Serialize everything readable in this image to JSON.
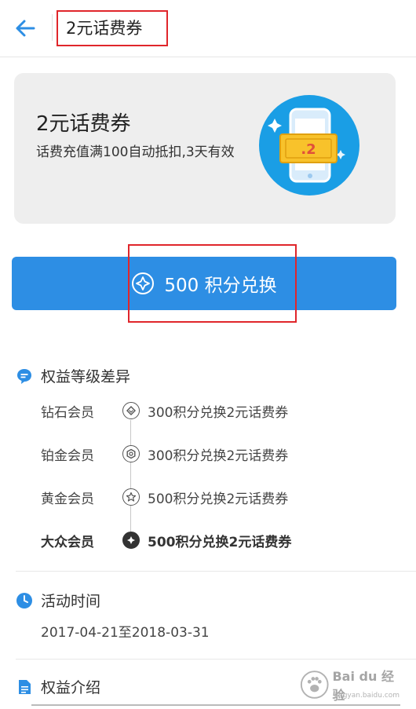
{
  "header": {
    "title": "2元话费券",
    "back_icon": "back-arrow-icon"
  },
  "card": {
    "title": "2元话费券",
    "description": "话费充值满100自动抵扣,3天有效",
    "illustration": "phone-coupon-icon",
    "coupon_value": ".2"
  },
  "redeem": {
    "label": "500 积分兑换",
    "icon": "points-diamond-icon"
  },
  "tiers_section": {
    "title": "权益等级差异",
    "icon": "chat-bubble-icon",
    "tiers": [
      {
        "name": "钻石会员",
        "text": "300积分兑换2元话费券",
        "icon": "diamond-icon",
        "active": false
      },
      {
        "name": "铂金会员",
        "text": "300积分兑换2元话费券",
        "icon": "hexagon-icon",
        "active": false
      },
      {
        "name": "黄金会员",
        "text": "500积分兑换2元话费券",
        "icon": "star-icon",
        "active": false
      },
      {
        "name": "大众会员",
        "text": "500积分兑换2元话费券",
        "icon": "diamond-filled-icon",
        "active": true
      }
    ]
  },
  "activity_section": {
    "title": "活动时间",
    "icon": "clock-icon",
    "date_range": "2017-04-21至2018-03-31"
  },
  "intro_section": {
    "title": "权益介绍",
    "icon": "document-icon"
  },
  "watermark": {
    "text": "Bai du 经验",
    "subtext": "jingyan.baidu.com"
  },
  "colors": {
    "accent": "#2d8ee4",
    "highlight": "#e0262b",
    "badge": "#1a9ee5"
  }
}
